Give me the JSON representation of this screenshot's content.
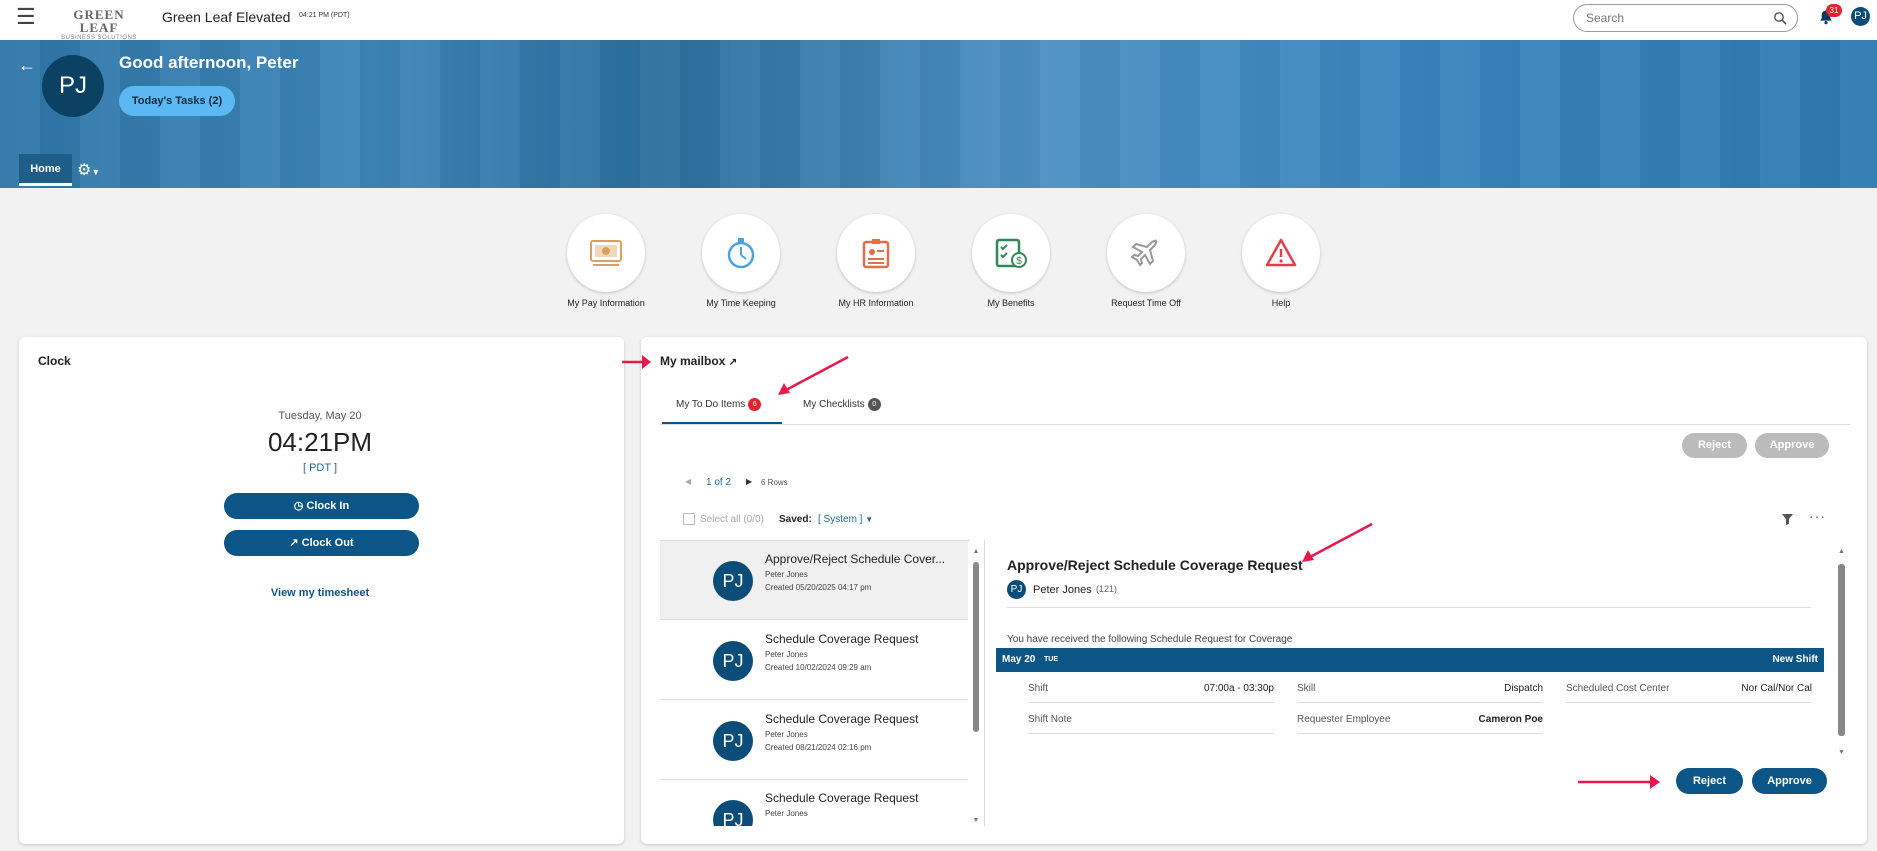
{
  "topbar": {
    "logo_line1": "GREEN LEAF",
    "logo_line2": "BUSINESS SOLUTIONS",
    "app_name": "Green Leaf Elevated",
    "time": "04:21 PM (PDT)",
    "search_placeholder": "Search",
    "notification_count": "31",
    "user_initials": "PJ"
  },
  "banner": {
    "initials": "PJ",
    "greeting": "Good afternoon, Peter",
    "tasks_button": "Today's Tasks (2)",
    "home_tab": "Home"
  },
  "quick_links": [
    {
      "label": "My Pay Information",
      "icon": "pay-information-icon",
      "color": "#d8a160"
    },
    {
      "label": "My Time Keeping",
      "icon": "stopwatch-icon",
      "color": "#4aa3df"
    },
    {
      "label": "My HR Information",
      "icon": "id-badge-icon",
      "color": "#e0704a"
    },
    {
      "label": "My Benefits",
      "icon": "benefits-checklist-icon",
      "color": "#2e8a55"
    },
    {
      "label": "Request Time Off",
      "icon": "airplane-icon",
      "color": "#999999"
    },
    {
      "label": "Help",
      "icon": "warning-icon",
      "color": "#e0404a"
    }
  ],
  "clock": {
    "title": "Clock",
    "date": "Tuesday, May 20",
    "time": "04:21PM",
    "timezone": "[ PDT ]",
    "clock_in": "Clock In",
    "clock_out": "Clock Out",
    "timesheet_link": "View my timesheet"
  },
  "mailbox": {
    "title": "My mailbox",
    "tabs": [
      {
        "label": "My To Do Items",
        "count": "6"
      },
      {
        "label": "My Checklists",
        "count": "0"
      }
    ],
    "reject_top": "Reject",
    "approve_top": "Approve",
    "pager": "1 of 2",
    "rows": "6 Rows",
    "select_all": "Select all (0/0)",
    "saved_label": "Saved:",
    "saved_value": "[ System ]",
    "items": [
      {
        "title": "Approve/Reject Schedule Cover...",
        "name": "Peter Jones",
        "created": "Created 05/20/2025 04:17 pm",
        "initials": "PJ"
      },
      {
        "title": "Schedule Coverage Request",
        "name": "Peter Jones",
        "created": "Created 10/02/2024 09:29 am",
        "initials": "PJ"
      },
      {
        "title": "Schedule Coverage Request",
        "name": "Peter Jones",
        "created": "Created 08/21/2024 02:16 pm",
        "initials": "PJ"
      },
      {
        "title": "Schedule Coverage Request",
        "name": "Peter Jones",
        "created": "",
        "initials": "PJ"
      }
    ],
    "detail": {
      "title": "Approve/Reject Schedule Coverage Request",
      "initials": "PJ",
      "person": "Peter Jones",
      "person_id": "(121)",
      "message": "You have received the following Schedule Request for Coverage",
      "date": "May 20",
      "day": "TUE",
      "shift_type": "New Shift",
      "shift_label": "Shift",
      "shift_value": "07:00a - 03:30p",
      "skill_label": "Skill",
      "skill_value": "Dispatch",
      "cost_label": "Scheduled Cost Center",
      "cost_value": "Nor Cal/Nor Cal",
      "note_label": "Shift Note",
      "requester_label": "Requester Employee",
      "requester_value": "Cameron Poe"
    },
    "reject_bottom": "Reject",
    "approve_bottom": "Approve"
  },
  "colors": {
    "brand_blue": "#0b5687",
    "annotation_arrow": "#e8184a",
    "badge_red": "#e1242d"
  }
}
